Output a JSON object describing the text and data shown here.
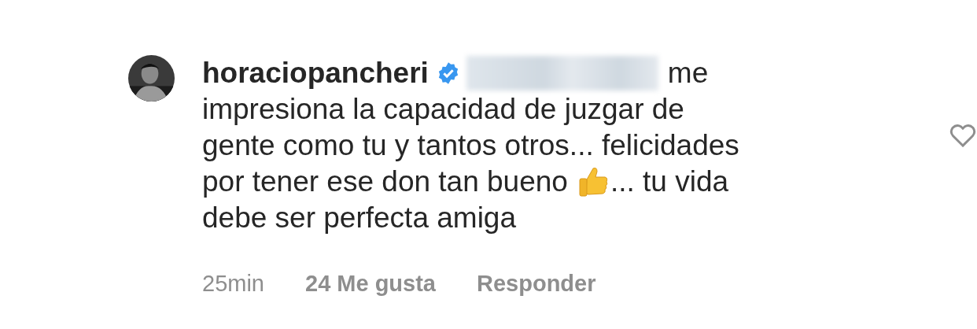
{
  "comment": {
    "username": "horaciopancheri",
    "verified": true,
    "mention_blurred": true,
    "lines": [
      [
        {
          "kind": "text",
          "text": "me"
        }
      ],
      [
        {
          "kind": "text",
          "text": "impresiona la capacidad de juzgar de"
        }
      ],
      [
        {
          "kind": "text",
          "text": "gente como tu y tantos otros... felicidades"
        }
      ],
      [
        {
          "kind": "text",
          "text": "por tener ese don tan bueno"
        },
        {
          "kind": "thumbs_up"
        },
        {
          "kind": "text",
          "text": "... tu vida"
        }
      ],
      [
        {
          "kind": "text",
          "text": "debe ser perfecta amiga"
        }
      ]
    ],
    "time": "25min",
    "likes": "24 Me gusta",
    "reply": "Responder",
    "liked": false
  }
}
